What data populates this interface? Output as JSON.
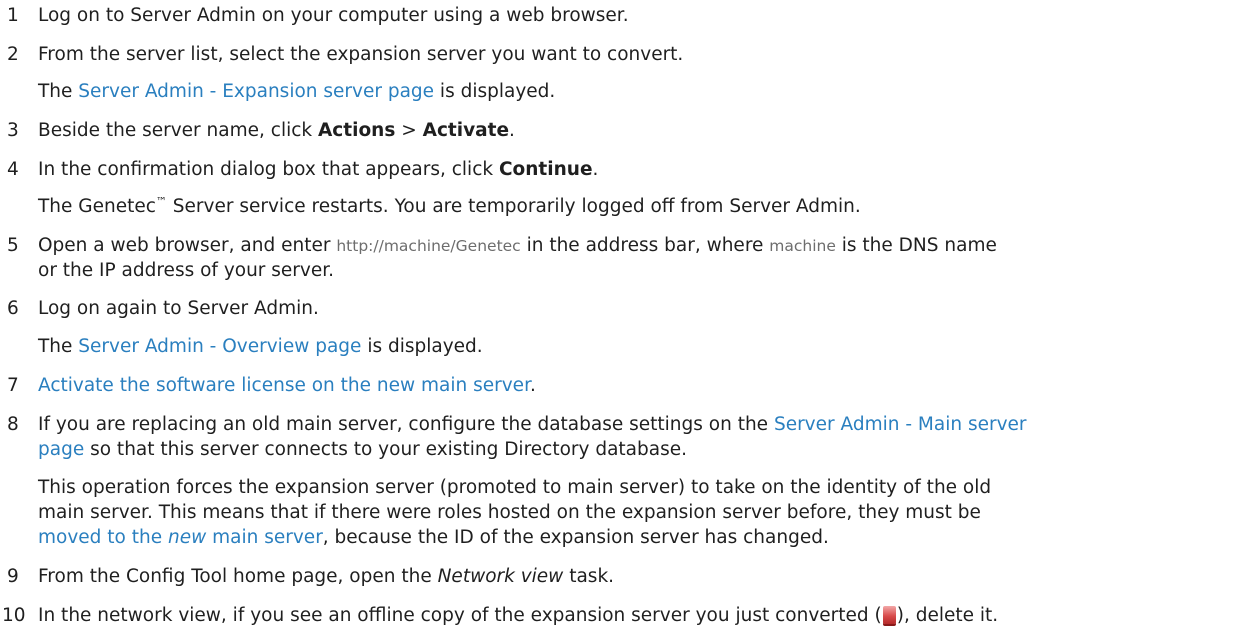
{
  "steps": {
    "s1": {
      "num": "1",
      "text": "Log on to Server Admin on your computer using a web browser."
    },
    "s2": {
      "num": "2",
      "text": "From the server list, select the expansion server you want to convert.",
      "result_pre": "The ",
      "result_link": "Server Admin - Expansion server page",
      "result_post": " is displayed."
    },
    "s3": {
      "num": "3",
      "pre": "Beside the server name, click ",
      "b1": "Actions",
      "mid": " > ",
      "b2": "Activate",
      "post": "."
    },
    "s4": {
      "num": "4",
      "pre": "In the confirmation dialog box that appears, click ",
      "b1": "Continue",
      "post": ".",
      "result_pre": "The Genetec",
      "result_tm": "™",
      "result_post": " Server service restarts. You are temporarily logged off from Server Admin."
    },
    "s5": {
      "num": "5",
      "pre": "Open a web browser, and enter ",
      "code1": "http://machine/Genetec",
      "mid": " in the address bar, where ",
      "code2": "machine",
      "post": " is the DNS name",
      "line2": "or the IP address of your server."
    },
    "s6": {
      "num": "6",
      "text": "Log on again to Server Admin.",
      "result_pre": "The ",
      "result_link": "Server Admin - Overview page",
      "result_post": " is displayed."
    },
    "s7": {
      "num": "7",
      "link": "Activate the software license on the new main server",
      "post": "."
    },
    "s8": {
      "num": "8",
      "pre": "If you are replacing an old main server, configure the database settings on the ",
      "link1": "Server Admin - Main server",
      "link1b": "page",
      "post": " so that this server connects to your existing Directory database.",
      "note1": "This operation forces the expansion server (promoted to main server) to take on the identity of the old",
      "note2": "main server. This means that if there were roles hosted on the expansion server before, they must be",
      "note3_link_pre": "moved to the ",
      "note3_link_i": "new",
      "note3_link_post": " main server",
      "note3_post": ", because the ID of the expansion server has changed."
    },
    "s9": {
      "num": "9",
      "pre": "From the Config Tool home page, open the ",
      "i1": "Network view",
      "post": " task."
    },
    "s10": {
      "num": "10",
      "pre": "In the network view, if you see an offline copy of the expansion server you just converted (",
      "post": "), delete it."
    }
  }
}
